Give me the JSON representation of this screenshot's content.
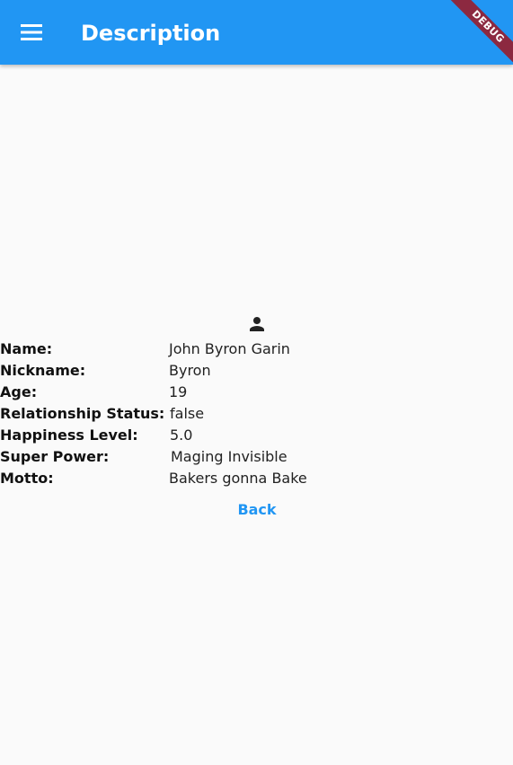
{
  "app_bar": {
    "title": "Description",
    "menu_icon": "menu-icon",
    "color": "#2196f3"
  },
  "debug_banner": {
    "label": "DEBUG",
    "color": "#8c2940"
  },
  "profile": {
    "icon": "person-icon",
    "fields": [
      {
        "label": "Name:",
        "value": "John Byron Garin"
      },
      {
        "label": "Nickname:",
        "value": "Byron"
      },
      {
        "label": "Age:",
        "value": "19"
      },
      {
        "label": "Relationship Status:",
        "value": "false"
      },
      {
        "label": "Happiness Level:",
        "value": "5.0"
      },
      {
        "label": "Super Power:",
        "value": "Maging Invisible"
      },
      {
        "label": "Motto:",
        "value": "Bakers gonna Bake"
      }
    ]
  },
  "actions": {
    "back_label": "Back"
  }
}
